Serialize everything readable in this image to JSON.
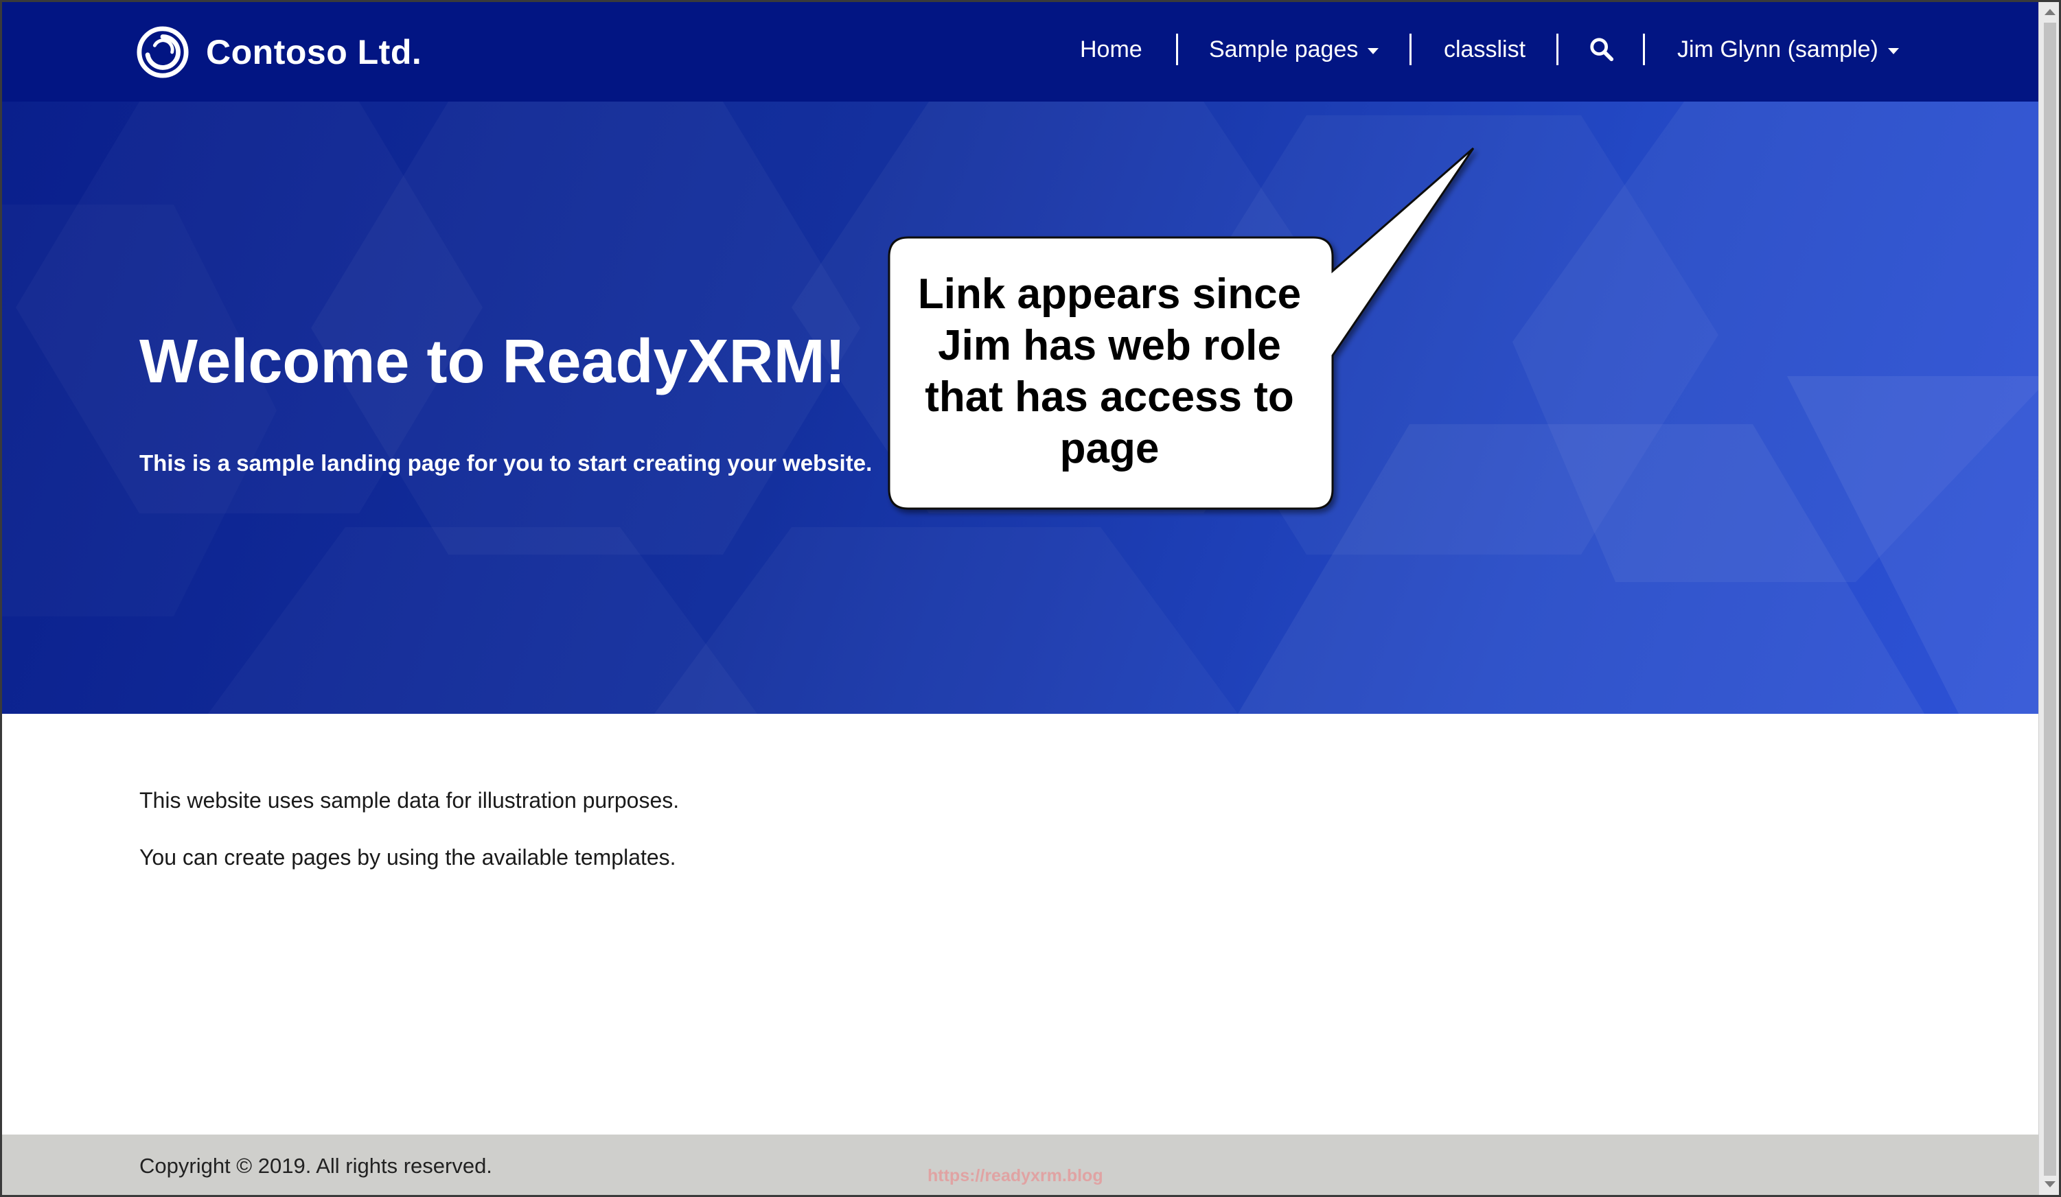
{
  "brand": {
    "name": "Contoso Ltd.",
    "logo_icon": "contoso-ring-logo"
  },
  "nav": {
    "home": "Home",
    "sample_pages": "Sample pages",
    "classlist": "classlist",
    "search_icon": "search-icon",
    "user": "Jim Glynn (sample)"
  },
  "hero": {
    "title": "Welcome to ReadyXRM!",
    "subtitle": "This is a sample landing page for you to start creating your website."
  },
  "callout": {
    "lines": [
      "Link appears since",
      "Jim has web role",
      "that has access to",
      "page"
    ]
  },
  "content": {
    "line1": "This website uses sample data for illustration purposes.",
    "line2": "You can create pages by using the available templates."
  },
  "footer": {
    "copyright": "Copyright © 2019. All rights reserved.",
    "watermark": "https://readyxrm.blog"
  },
  "colors": {
    "navbar": "#021583",
    "hero_start": "#0a1f8c",
    "hero_end": "#2e52d6",
    "footer": "#cfcfcc"
  }
}
